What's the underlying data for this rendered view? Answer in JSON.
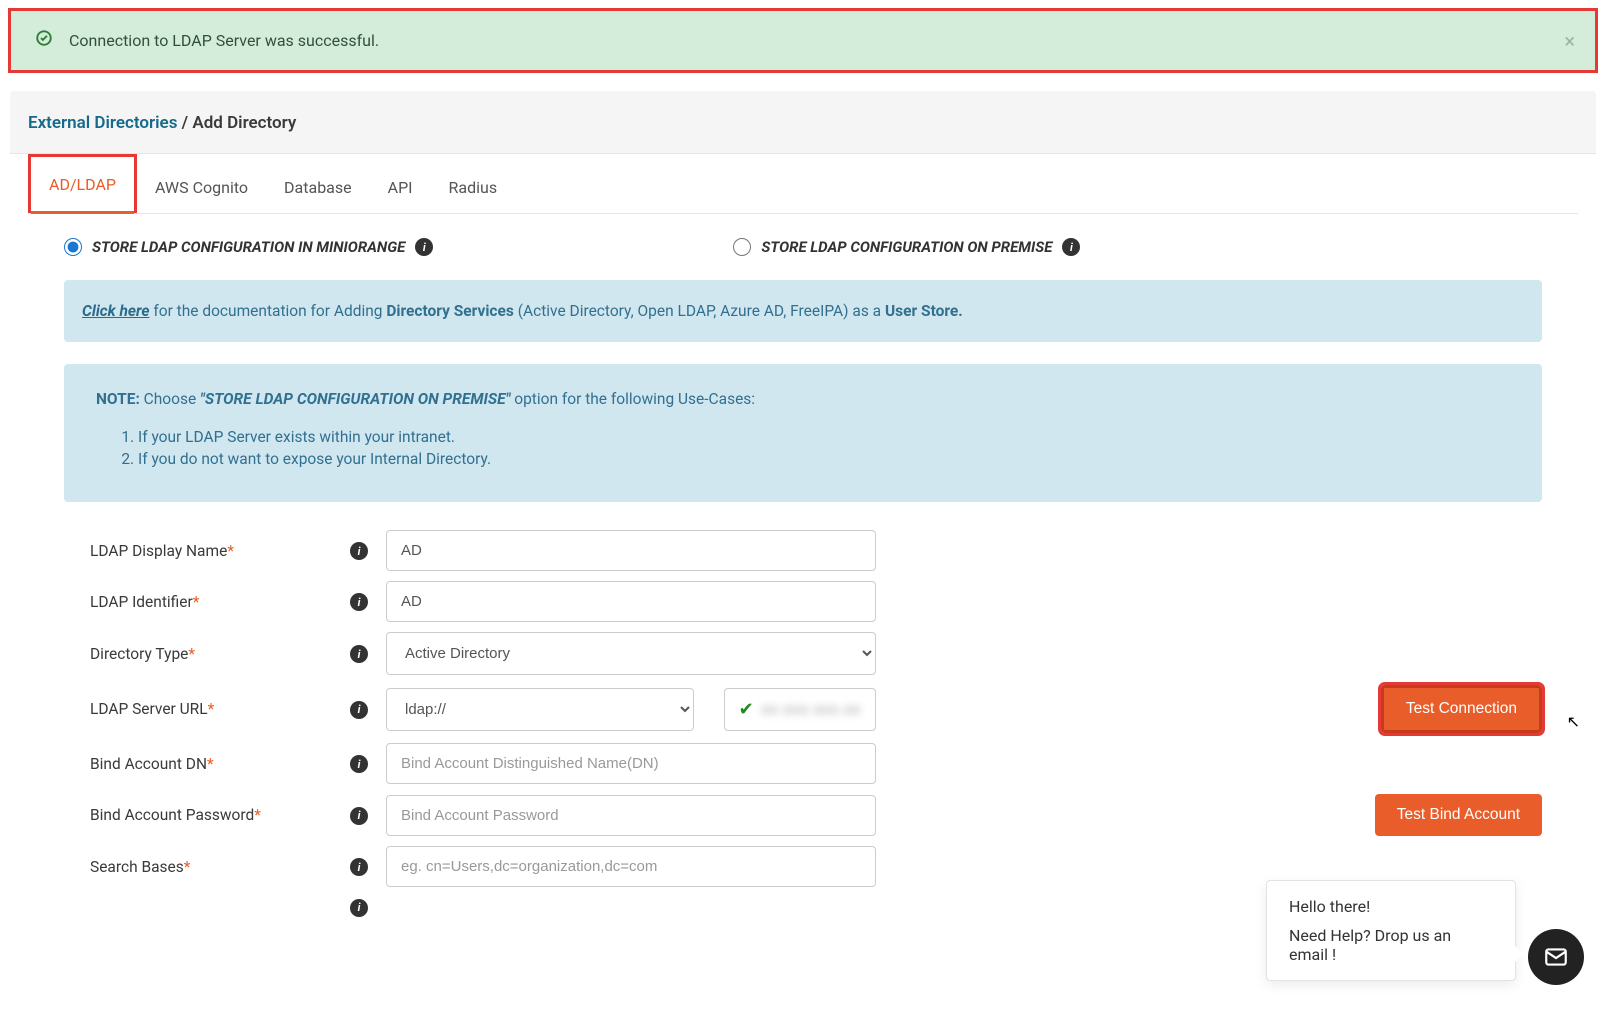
{
  "alert": {
    "message": "Connection to LDAP Server was successful."
  },
  "breadcrumb": {
    "parent": "External Directories",
    "separator": " / ",
    "current": "Add Directory"
  },
  "tabs": {
    "adldap": "AD/LDAP",
    "cognito": "AWS Cognito",
    "database": "Database",
    "api": "API",
    "radius": "Radius"
  },
  "radio": {
    "miniorange": "STORE LDAP CONFIGURATION IN MINIORANGE",
    "onpremise": "STORE LDAP CONFIGURATION ON PREMISE"
  },
  "doc_banner": {
    "click": "Click here",
    "mid1": " for the documentation for Adding ",
    "strong": "Directory Services",
    "mid2": " (Active Directory, Open LDAP, Azure AD, FreeIPA) as a ",
    "userstore": "User Store."
  },
  "note": {
    "label": "NOTE:",
    "choose": "  Choose ",
    "quoted": "\"STORE LDAP CONFIGURATION ON PREMISE\"",
    "tail": " option for the following Use-Cases:",
    "item1": "If your LDAP Server exists within your intranet.",
    "item2": "If you do not want to expose your Internal Directory."
  },
  "fields": {
    "display_name": {
      "label": "LDAP Display Name",
      "value": "AD"
    },
    "identifier": {
      "label": "LDAP Identifier",
      "value": "AD"
    },
    "directory_type": {
      "label": "Directory Type",
      "value": "Active Directory"
    },
    "server_url": {
      "label": "LDAP Server URL",
      "protocol": "ldap://",
      "host_blur": "xx.xxx.xxx.xx"
    },
    "bind_dn": {
      "label": "Bind Account DN",
      "placeholder": "Bind Account Distinguished Name(DN)"
    },
    "bind_pw": {
      "label": "Bind Account Password",
      "placeholder": "Bind Account Password"
    },
    "search_bases": {
      "label": "Search Bases",
      "placeholder": "eg. cn=Users,dc=organization,dc=com"
    }
  },
  "buttons": {
    "test_connection": "Test Connection",
    "test_bind": "Test Bind Account"
  },
  "chat": {
    "greeting": "Hello there!",
    "help": "Need Help? Drop us an email !"
  }
}
